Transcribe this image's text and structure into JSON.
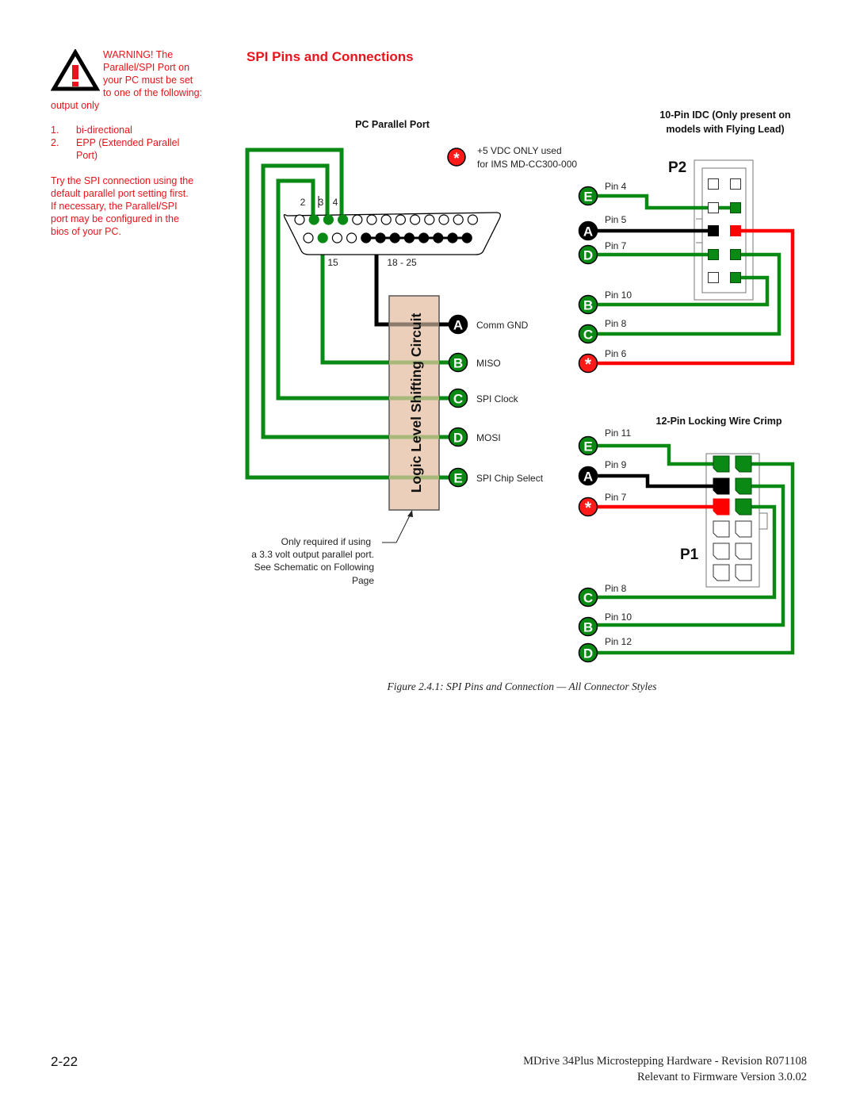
{
  "warning": {
    "heading_lines": [
      "WARNING! The",
      "Parallel/SPI Port on",
      "your PC must be set",
      "to one of the following:"
    ],
    "line_output_only": "output only",
    "list": [
      {
        "num": "1.",
        "text": "bi-directional"
      },
      {
        "num": "2.",
        "text": "EPP (Extended Parallel"
      },
      {
        "num": "",
        "text": "Port)"
      }
    ],
    "note_lines": [
      "Try the SPI connection using the",
      "default parallel port setting first.",
      "If necessary, the Parallel/SPI",
      "port may be configured in the",
      "bios of your PC."
    ],
    "icon": "warning-triangle-icon"
  },
  "title": "SPI Pins and Connections",
  "diagram": {
    "colors": {
      "green": "#0a8a14",
      "black": "#000000",
      "red": "#ff0000",
      "circuit_fill": "#eccfba",
      "title_red": "#e8141c"
    },
    "pc_port": {
      "label": "PC Parallel Port",
      "pin_labels": {
        "p2": "2",
        "p3": "3",
        "p4": "4",
        "p15": "15",
        "p18_25": "18 - 25"
      }
    },
    "power_note": {
      "lines": [
        "+5 VDC ONLY used",
        "for IMS MD-CC300-000"
      ],
      "symbol": "*"
    },
    "circuit": {
      "label": "Logic Level Shifting Circuit"
    },
    "signals": [
      {
        "letter": "A",
        "name": "Comm GND",
        "color": "black"
      },
      {
        "letter": "B",
        "name": "MISO",
        "color": "green"
      },
      {
        "letter": "C",
        "name": "SPI Clock",
        "color": "green"
      },
      {
        "letter": "D",
        "name": "MOSI",
        "color": "green"
      },
      {
        "letter": "E",
        "name": "SPI Chip Select",
        "color": "green"
      }
    ],
    "circuit_note": {
      "lines": [
        "Only required if using",
        "a 3.3 volt output parallel port.",
        "See Schematic on Following",
        "Page"
      ]
    },
    "p2": {
      "heading_lines": [
        "10-Pin IDC (Only present on",
        "models with Flying Lead)"
      ],
      "label": "P2",
      "pins": [
        {
          "letter": "E",
          "pin": "Pin 4"
        },
        {
          "letter": "A",
          "pin": "Pin 5"
        },
        {
          "letter": "D",
          "pin": "Pin 7"
        },
        {
          "letter": "B",
          "pin": "Pin 10"
        },
        {
          "letter": "C",
          "pin": "Pin 8"
        },
        {
          "letter": "*",
          "pin": "Pin 6"
        }
      ]
    },
    "p1": {
      "heading": "12-Pin Locking Wire Crimp",
      "label": "P1",
      "pins": [
        {
          "letter": "E",
          "pin": "Pin 11"
        },
        {
          "letter": "A",
          "pin": "Pin 9"
        },
        {
          "letter": "*",
          "pin": "Pin 7"
        },
        {
          "letter": "C",
          "pin": "Pin 8"
        },
        {
          "letter": "B",
          "pin": "Pin 10"
        },
        {
          "letter": "D",
          "pin": "Pin 12"
        }
      ]
    }
  },
  "caption": "Figure 2.4.1: SPI Pins and Connection — All Connector Styles",
  "footer": {
    "page_number": "2-22",
    "line1": "MDrive 34Plus Microstepping Hardware - Revision R071108",
    "line2": "Relevant to Firmware Version 3.0.02"
  }
}
